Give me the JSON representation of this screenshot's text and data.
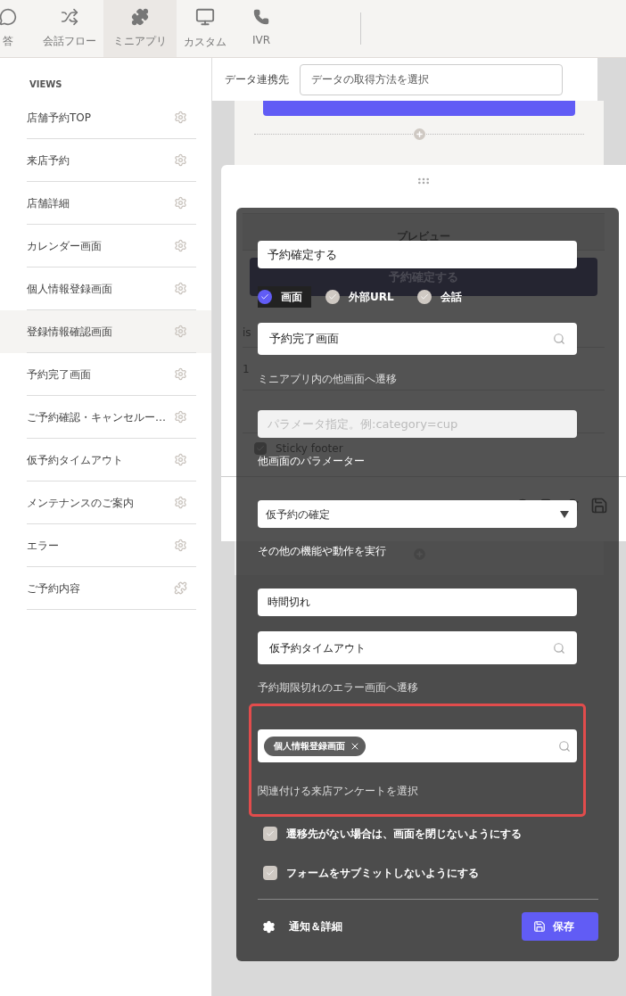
{
  "nav": {
    "items": [
      {
        "label": "答",
        "selected": false
      },
      {
        "label": "会話フロー",
        "selected": false
      },
      {
        "label": "ミニアプリ",
        "selected": true
      },
      {
        "label": "カスタム",
        "selected": false
      },
      {
        "label": "IVR",
        "selected": false
      }
    ]
  },
  "sidebar": {
    "heading": "VIEWS",
    "items": [
      {
        "label": "店舗予約TOP",
        "kind": "view",
        "selected": false
      },
      {
        "label": "来店予約",
        "kind": "view",
        "selected": false
      },
      {
        "label": "店舗詳細",
        "kind": "view",
        "selected": false
      },
      {
        "label": "カレンダー画面",
        "kind": "view",
        "selected": false
      },
      {
        "label": "個人情報登録画面",
        "kind": "view",
        "selected": false
      },
      {
        "label": "登録情報確認画面",
        "kind": "view",
        "selected": true
      },
      {
        "label": "予約完了画面",
        "kind": "view",
        "selected": false
      },
      {
        "label": "ご予約確認・キャンセルー…",
        "kind": "view",
        "selected": false
      },
      {
        "label": "仮予約タイムアウト",
        "kind": "view",
        "selected": false
      },
      {
        "label": "メンテナンスのご案内",
        "kind": "view",
        "selected": false
      },
      {
        "label": "エラー",
        "kind": "view",
        "selected": false
      },
      {
        "label": "ご予約内容",
        "kind": "component",
        "selected": false
      }
    ]
  },
  "data_source": {
    "label": "データ連携先",
    "placeholder": "データの取得方法を選択"
  },
  "preview": {
    "heading": "プレビュー",
    "button": "予約確定する",
    "row_labels": [
      "is",
      "1"
    ],
    "sticky_footer": {
      "label": "Sticky footer",
      "checked": true
    }
  },
  "editor": {
    "button_label": "予約確定する",
    "targets": [
      {
        "label": "画面",
        "selected": true
      },
      {
        "label": "外部URL",
        "selected": false
      },
      {
        "label": "会話",
        "selected": false
      }
    ],
    "screen": {
      "value": "予約完了画面",
      "hint": "ミニアプリ内の他画面へ遷移"
    },
    "params": {
      "placeholder": "パラメータ指定。例:category=cup",
      "hint": "他画面のパラメーター"
    },
    "action": {
      "value": "仮予約の確定",
      "hint": "その他の機能や動作を実行"
    },
    "timeout_label": {
      "value": "時間切れ"
    },
    "timeout_screen": {
      "value": "仮予約タイムアウト",
      "hint": "予約期限切れのエラー画面へ遷移"
    },
    "survey": {
      "tags": [
        "個人情報登録画面"
      ],
      "hint": "関連付ける来店アンケートを選択"
    },
    "options": [
      {
        "label": "遷移先がない場合は、画面を閉じないようにする",
        "checked": true
      },
      {
        "label": "フォームをサブミットしないようにする",
        "checked": true
      }
    ],
    "details": "通知＆詳細",
    "save": "保存"
  }
}
